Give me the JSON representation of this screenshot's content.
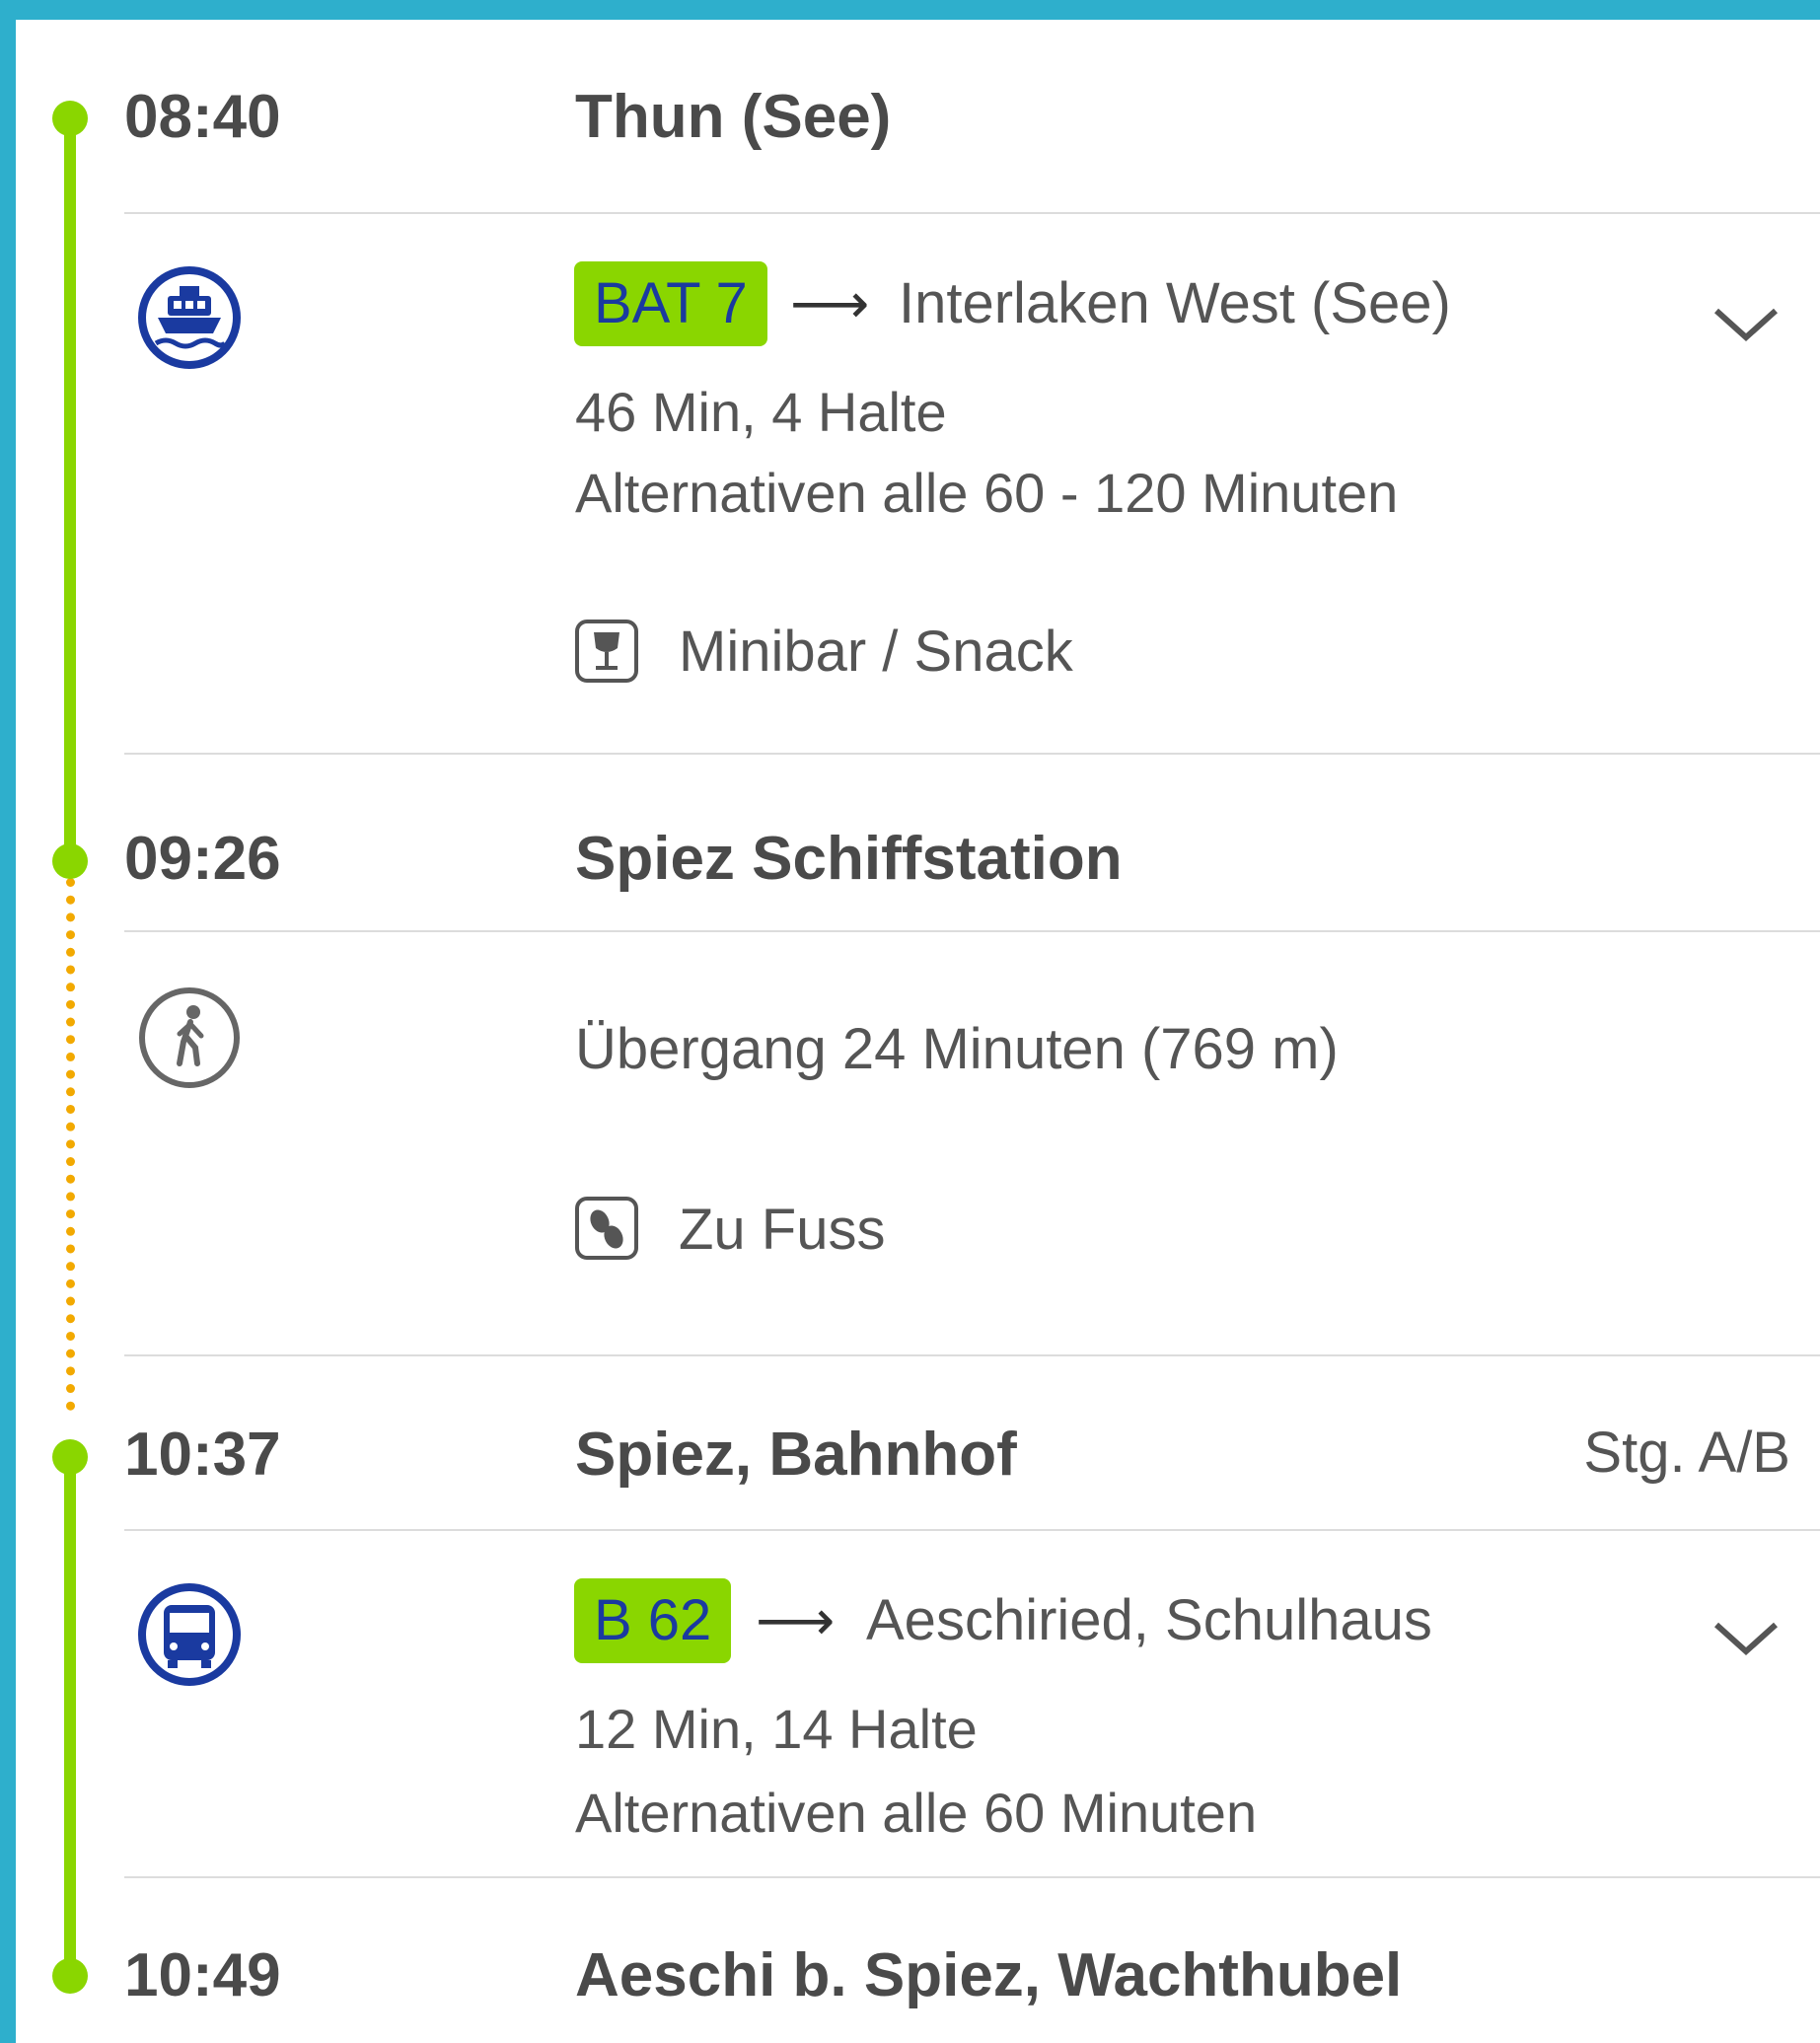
{
  "colors": {
    "frame": "#2eafcc",
    "route_line": "#8ad600",
    "walk_line": "#f2a900",
    "badge_bg": "#8ad600",
    "badge_text": "#1a3aa0",
    "mode_icon": "#1a3aa0"
  },
  "stops": [
    {
      "time": "08:40",
      "name": "Thun (See)",
      "platform": ""
    },
    {
      "time": "09:26",
      "name": "Spiez Schiffstation",
      "platform": ""
    },
    {
      "time": "10:37",
      "name": "Spiez, Bahnhof",
      "platform": "Stg. A/B"
    },
    {
      "time": "10:49",
      "name": "Aeschi b. Spiez, Wachthubel",
      "platform": ""
    }
  ],
  "legs": [
    {
      "mode_icon": "ship-icon",
      "line": "BAT 7",
      "arrow": "⟶",
      "direction": "Interlaken West (See)",
      "duration": "46 Min, 4 Halte",
      "alternatives": "Alternativen alle 60 - 120 Minuten",
      "feature_icon": "minibar-icon",
      "feature": "Minibar / Snack"
    },
    {
      "mode_icon": "walk-icon",
      "transfer": "Übergang 24 Minuten (769 m)",
      "feature_icon": "footsteps-icon",
      "feature": "Zu Fuss"
    },
    {
      "mode_icon": "bus-icon",
      "line": "B 62",
      "arrow": "⟶",
      "direction": "Aeschiried, Schulhaus",
      "duration": "12 Min, 14 Halte",
      "alternatives": "Alternativen alle 60 Minuten"
    }
  ]
}
